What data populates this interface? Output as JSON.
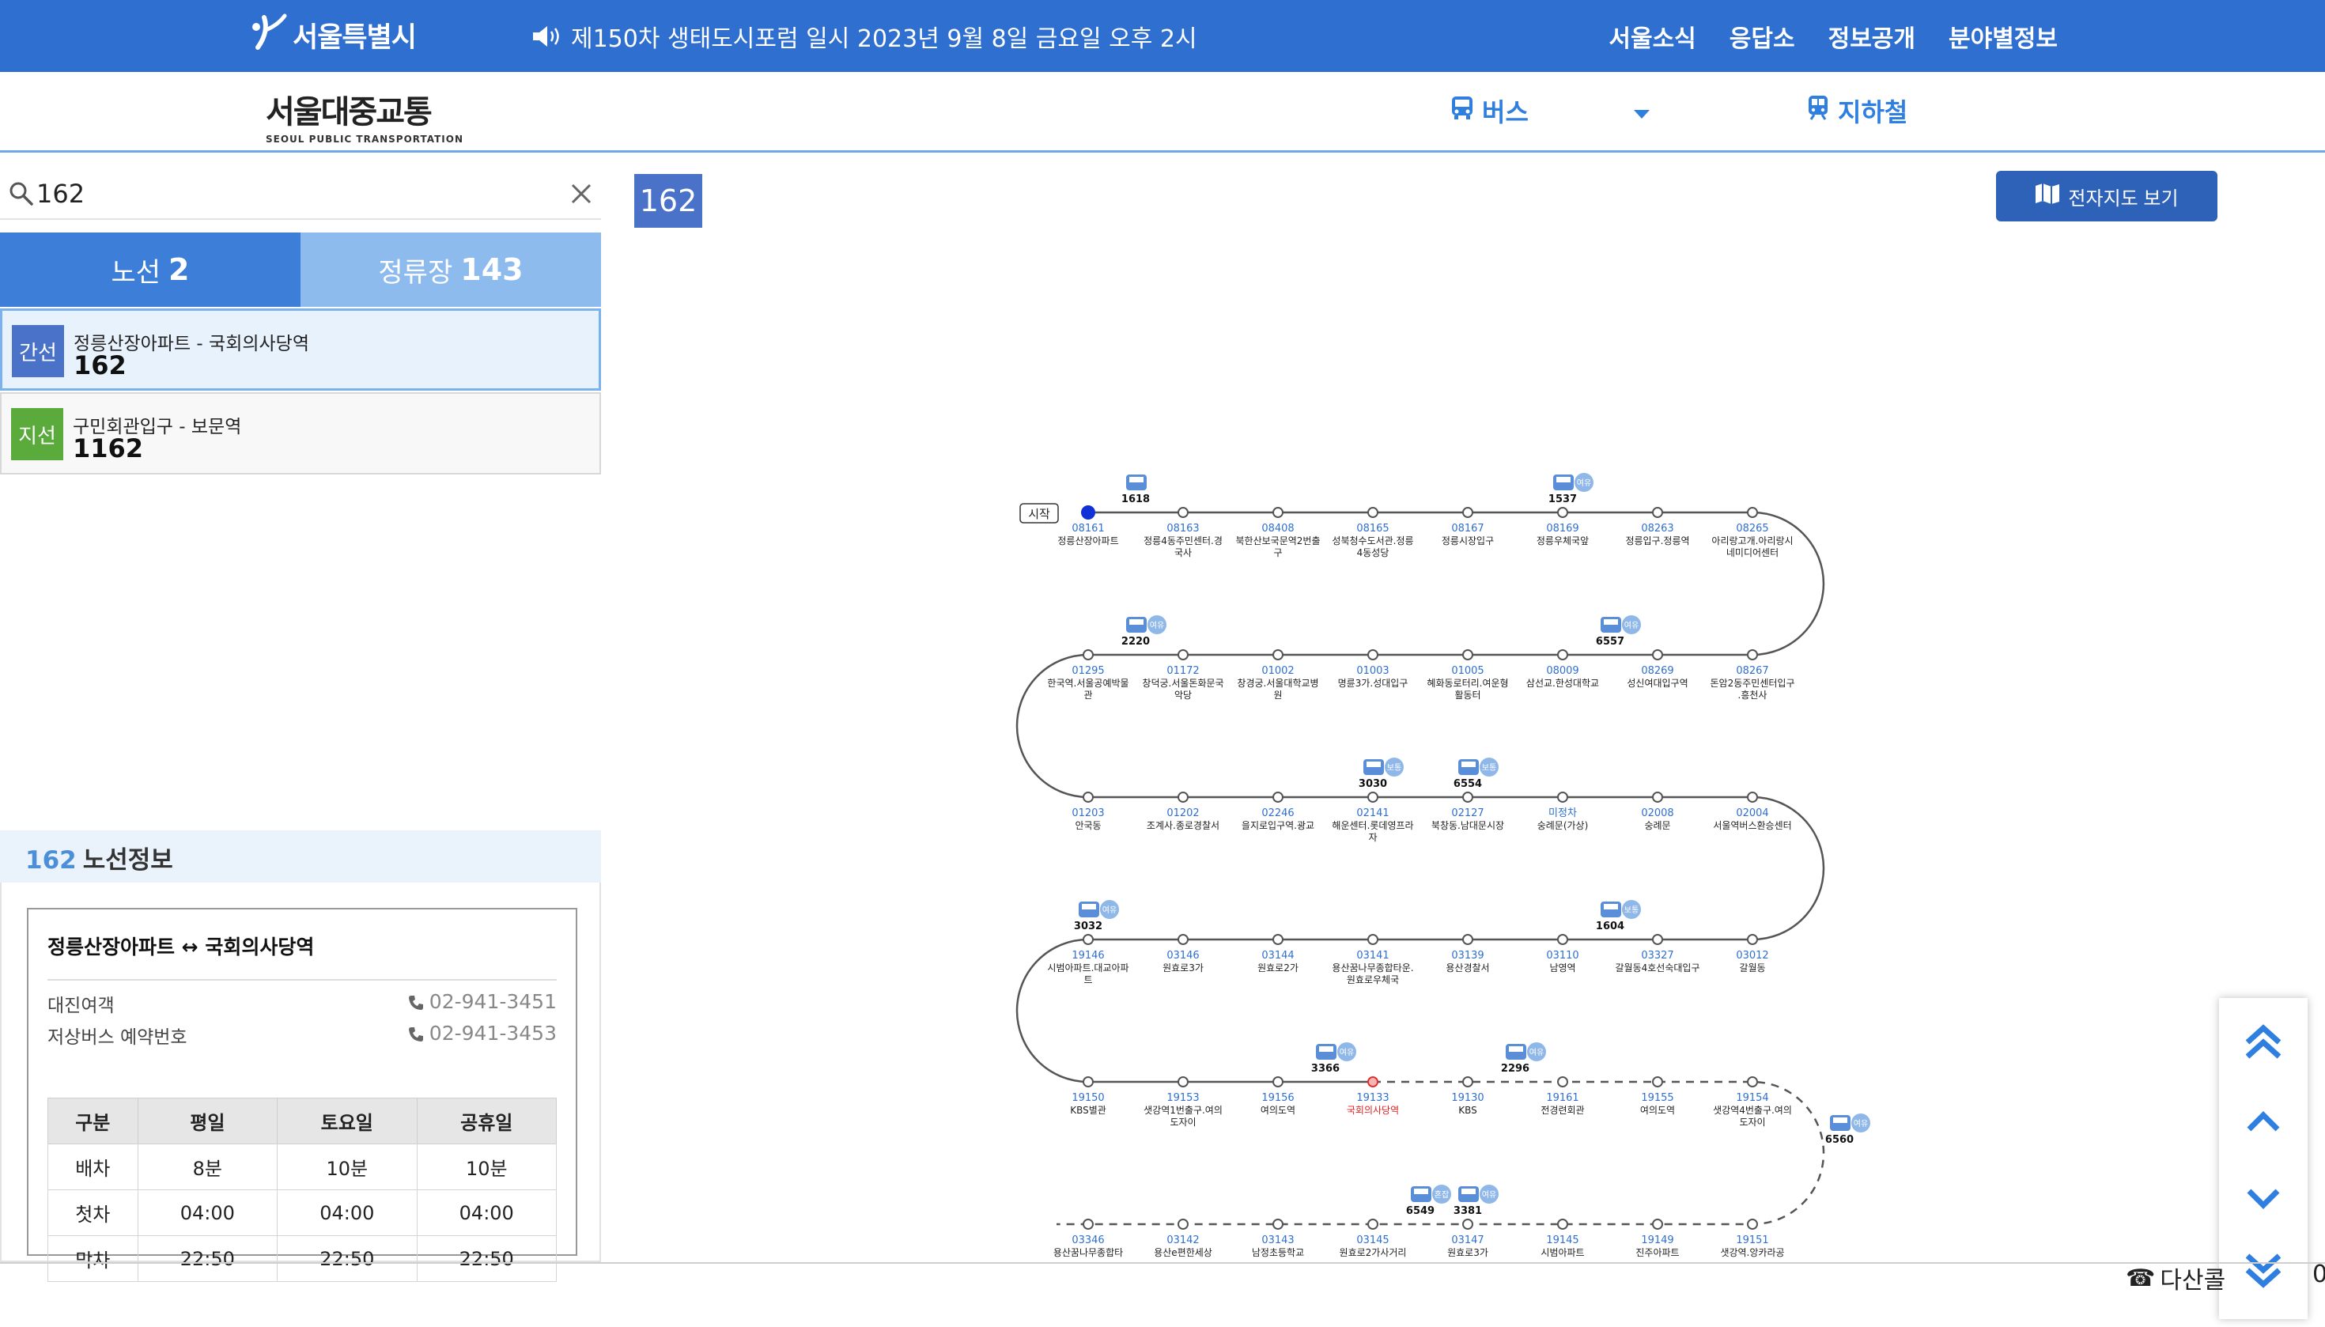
{
  "topbar": {
    "logo_text": "서울특별시",
    "notice": "제150차 생태도시포럼 일시 2023년 9월 8일 금요일 오후 2시",
    "nav": [
      "서울소식",
      "응답소",
      "정보공개",
      "분야별정보"
    ]
  },
  "header": {
    "brand_title": "서울대중교통",
    "brand_sub": "SEOUL PUBLIC TRANSPORTATION",
    "mode_bus": "버스",
    "mode_subway": "지하철"
  },
  "search": {
    "value": "162"
  },
  "tabs": [
    {
      "label": "노선",
      "count": "2"
    },
    {
      "label": "정류장",
      "count": "143"
    }
  ],
  "routes": [
    {
      "type": "간선",
      "color": "#4a72c8",
      "desc": "정릉산장아파트 - 국회의사당역",
      "num": "162"
    },
    {
      "type": "지선",
      "color": "#5aab3b",
      "desc": "구민회관입구 - 보문역",
      "num": "1162"
    }
  ],
  "route_info": {
    "num": "162",
    "title": "노선정보",
    "endpoints": "정릉산장아파트 ↔ 국회의사당역",
    "company": "대진여객",
    "company_phone": "02-941-3451",
    "lowfloor_label": "저상버스 예약번호",
    "lowfloor_phone": "02-941-3453",
    "schedule": {
      "headers": [
        "구분",
        "평일",
        "토요일",
        "공휴일"
      ],
      "rows": [
        [
          "배차",
          "8분",
          "10분",
          "10분"
        ],
        [
          "첫차",
          "04:00",
          "04:00",
          "04:00"
        ],
        [
          "막차",
          "22:50",
          "22:50",
          "22:50"
        ]
      ]
    }
  },
  "main": {
    "route_chip": "162",
    "emap_button": "전자지도 보기",
    "start_label": "시작",
    "bus_tag_label": "여유",
    "bus_tag_label_normal": "보통",
    "bus_tag_label_crowd": "혼잡"
  },
  "map_rows": [
    [
      {
        "id": "08161",
        "name": "정릉산장아파트"
      },
      {
        "id": "08163",
        "name": "정릉4동주민센터.경국사"
      },
      {
        "id": "08408",
        "name": "북한산보국문역2번출구"
      },
      {
        "id": "08165",
        "name": "성북청수도서관.정릉4동성당"
      },
      {
        "id": "08167",
        "name": "정릉시장입구"
      },
      {
        "id": "08169",
        "name": "정릉우체국앞"
      },
      {
        "id": "08263",
        "name": "정릉입구.정릉역"
      },
      {
        "id": "08265",
        "name": "아리랑고개.아리랑시네미디어센터"
      }
    ],
    [
      {
        "id": "01295",
        "name": "한국역.서울공예박물관"
      },
      {
        "id": "01172",
        "name": "창덕궁.서울돈화문국악당"
      },
      {
        "id": "01002",
        "name": "창경궁.서울대학교병원"
      },
      {
        "id": "01003",
        "name": "명륜3가.성대입구"
      },
      {
        "id": "01005",
        "name": "혜화동로터리.여운형활동터"
      },
      {
        "id": "08009",
        "name": "삼선교.한성대학교"
      },
      {
        "id": "08269",
        "name": "성신여대입구역"
      },
      {
        "id": "08267",
        "name": "돈암2동주민센터입구.흥천사"
      }
    ],
    [
      {
        "id": "01203",
        "name": "안국동"
      },
      {
        "id": "01202",
        "name": "조계사.종로경찰서"
      },
      {
        "id": "02246",
        "name": "을지로입구역.광교"
      },
      {
        "id": "02141",
        "name": "해운센터.롯데영프라자"
      },
      {
        "id": "02127",
        "name": "북창동.남대문시장"
      },
      {
        "id": "미정차",
        "name": "숭례문(가상)"
      },
      {
        "id": "02008",
        "name": "숭례문"
      },
      {
        "id": "02004",
        "name": "서울역버스환승센터"
      }
    ],
    [
      {
        "id": "19146",
        "name": "시범아파트.대교아파트"
      },
      {
        "id": "03146",
        "name": "원효로3가"
      },
      {
        "id": "03144",
        "name": "원효로2가"
      },
      {
        "id": "03141",
        "name": "용산꿈나무종합타운.원효로우체국"
      },
      {
        "id": "03139",
        "name": "용산경찰서"
      },
      {
        "id": "03110",
        "name": "남영역"
      },
      {
        "id": "03327",
        "name": "갈월동4호선숙대입구"
      },
      {
        "id": "03012",
        "name": "갈월동"
      }
    ],
    [
      {
        "id": "19150",
        "name": "KBS별관"
      },
      {
        "id": "19153",
        "name": "샛강역1번출구.여의도자이"
      },
      {
        "id": "19156",
        "name": "여의도역"
      },
      {
        "id": "19133",
        "name": "국회의사당역"
      },
      {
        "id": "19130",
        "name": "KBS"
      },
      {
        "id": "19161",
        "name": "전경련회관"
      },
      {
        "id": "19155",
        "name": "여의도역"
      },
      {
        "id": "19154",
        "name": "샛강역4번출구.여의도자이"
      }
    ],
    [
      {
        "id": "03346",
        "name": "용산꿈나무종합타"
      },
      {
        "id": "03142",
        "name": "용산e편한세상"
      },
      {
        "id": "03143",
        "name": "남정초등학교"
      },
      {
        "id": "03145",
        "name": "원효로2가사거리"
      },
      {
        "id": "03147",
        "name": "원효로3가"
      },
      {
        "id": "19145",
        "name": "시범아파트"
      },
      {
        "id": "19149",
        "name": "진주아파트"
      },
      {
        "id": "19151",
        "name": "샛강역.앙카라공"
      }
    ]
  ],
  "buses": [
    {
      "num": "1618",
      "row": 0,
      "pos": 0.5,
      "tag": ""
    },
    {
      "num": "1537",
      "row": 0,
      "pos": 5,
      "tag": "여유"
    },
    {
      "num": "2220",
      "row": 1,
      "pos": 0.5,
      "tag": "여유"
    },
    {
      "num": "6557",
      "row": 1,
      "pos": 5.5,
      "tag": "여유"
    },
    {
      "num": "3030",
      "row": 2,
      "pos": 3,
      "tag": "보통"
    },
    {
      "num": "6554",
      "row": 2,
      "pos": 4,
      "tag": "보통"
    },
    {
      "num": "3032",
      "row": 3,
      "pos": 0,
      "tag": "여유"
    },
    {
      "num": "1604",
      "row": 3,
      "pos": 5.5,
      "tag": "보통"
    },
    {
      "num": "3366",
      "row": 4,
      "pos": 2.5,
      "tag": "여유"
    },
    {
      "num": "2296",
      "row": 4,
      "pos": 4.5,
      "tag": "여유"
    },
    {
      "num": "6560",
      "row": 4,
      "pos": 8,
      "tag": "여유"
    },
    {
      "num": "6549",
      "row": 5,
      "pos": 3.5,
      "tag": "혼잡"
    },
    {
      "num": "3381",
      "row": 5,
      "pos": 4,
      "tag": "여유"
    }
  ],
  "footer": {
    "dasan": "다산콜",
    "dasan_tail": "0"
  }
}
